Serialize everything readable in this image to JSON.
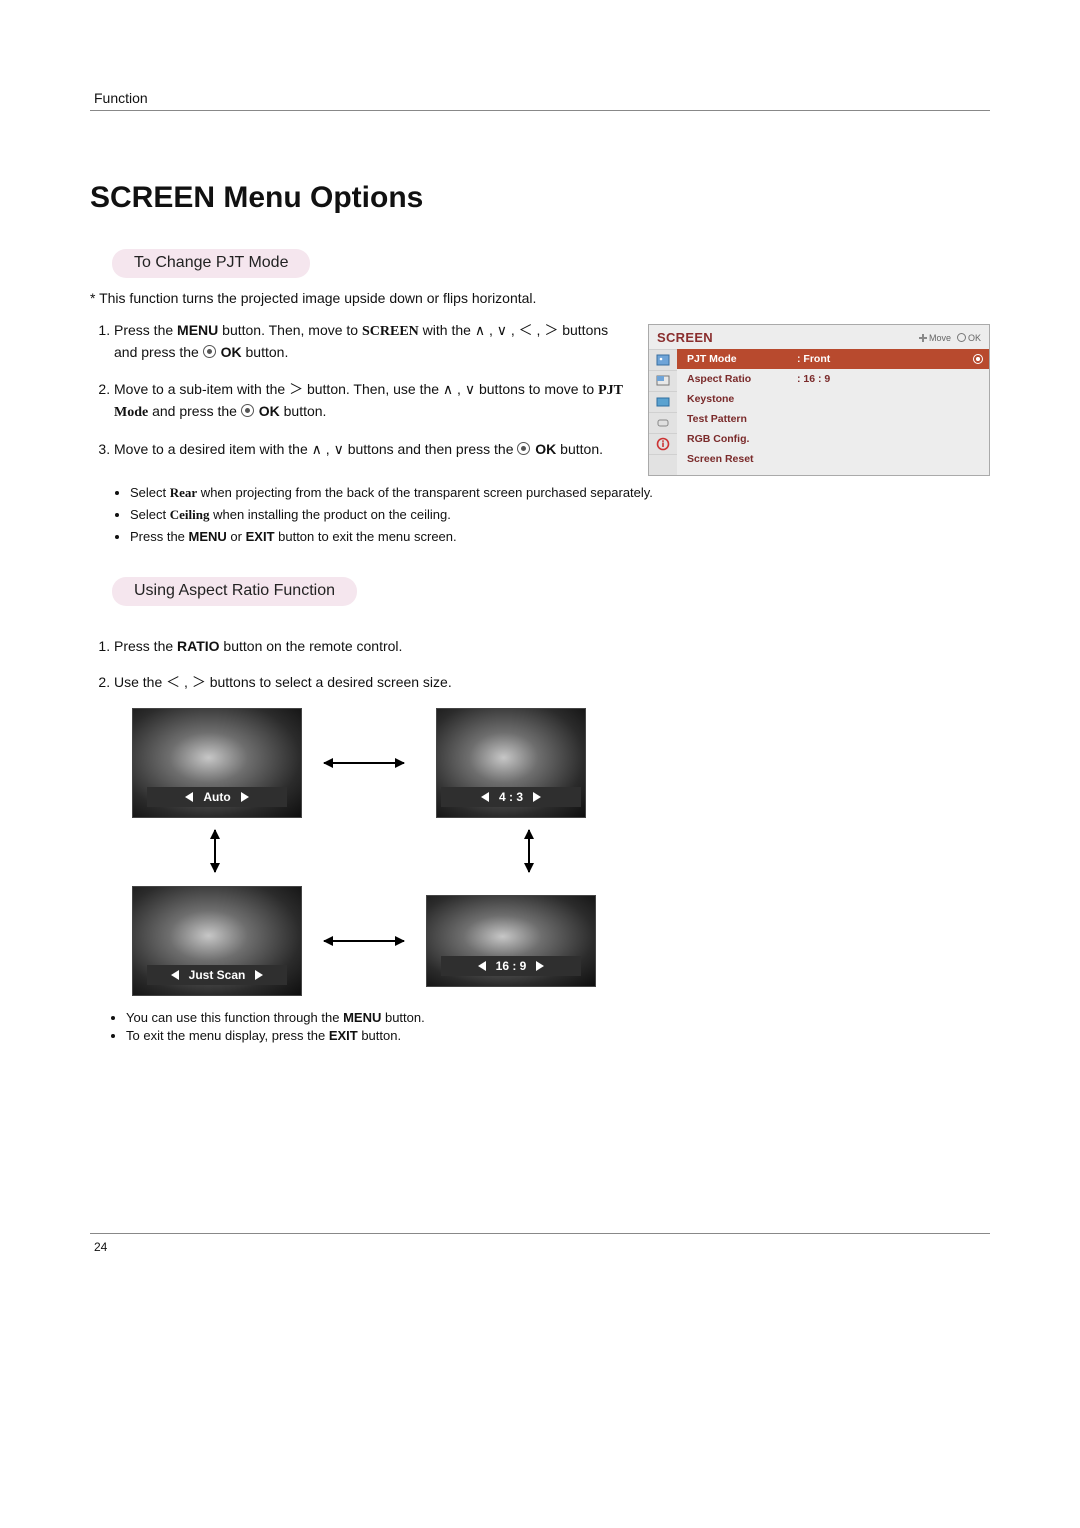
{
  "running_head": "Function",
  "title": "SCREEN Menu Options",
  "pill1": "To Change PJT Mode",
  "intro_note": "* This function turns the projected image upside down or flips horizontal.",
  "steps1": {
    "s1a": "Press the ",
    "s1_menu": "MENU",
    "s1b": " button. Then, move to ",
    "s1_screen": "SCREEN",
    "s1c": " with the ",
    "s1d": " buttons and press the ",
    "s1_ok": "OK",
    "s1e": " button.",
    "s2a": "Move to a sub-item with the ",
    "s2b": " button. Then, use the ",
    "s2c": " buttons to move to ",
    "s2_pjt": "PJT Mode",
    "s2d": " and press the ",
    "s2_ok": "OK",
    "s2e": " button.",
    "s3a": "Move to a desired item with the ",
    "s3b": " buttons and then press the ",
    "s3_ok": "OK",
    "s3c": " button."
  },
  "bullets1": {
    "b1a": "Select ",
    "b1_rear": "Rear",
    "b1b": " when projecting from the back of the transparent screen purchased separately.",
    "b2a": "Select ",
    "b2_ceiling": "Ceiling",
    "b2b": " when installing the product on the ceiling.",
    "b3a": "Press the ",
    "b3_menu": "MENU",
    "b3_or": " or ",
    "b3_exit": "EXIT",
    "b3b": " button to exit the menu screen."
  },
  "osd": {
    "title": "SCREEN",
    "hint_move": "Move",
    "hint_ok": "OK",
    "rows": [
      {
        "label": "PJT Mode",
        "value": ": Front"
      },
      {
        "label": "Aspect Ratio",
        "value": ": 16 : 9"
      },
      {
        "label": "Keystone",
        "value": ""
      },
      {
        "label": "Test Pattern",
        "value": ""
      },
      {
        "label": "RGB Config.",
        "value": ""
      },
      {
        "label": "Screen Reset",
        "value": ""
      }
    ]
  },
  "pill2": "Using Aspect Ratio Function",
  "steps2": {
    "s1a": "Press the ",
    "s1_ratio": "RATIO",
    "s1b": " button on the remote control.",
    "s2a": "Use the ",
    "s2b": " buttons to select a desired screen size."
  },
  "thumbs": {
    "auto": "Auto",
    "four_three": "4 : 3",
    "just_scan": "Just Scan",
    "sixteen_nine": "16 : 9"
  },
  "bullets2": {
    "b1a": "You can use this function through the ",
    "b1_menu": "MENU",
    "b1b": " button.",
    "b2a": "To exit the menu display, press the ",
    "b2_exit": "EXIT",
    "b2b": " button."
  },
  "page_number": "24",
  "glyphs": {
    "up": "∧",
    "down": "∨",
    "lt": "＜",
    "gt": "＞",
    "comma": " , "
  }
}
